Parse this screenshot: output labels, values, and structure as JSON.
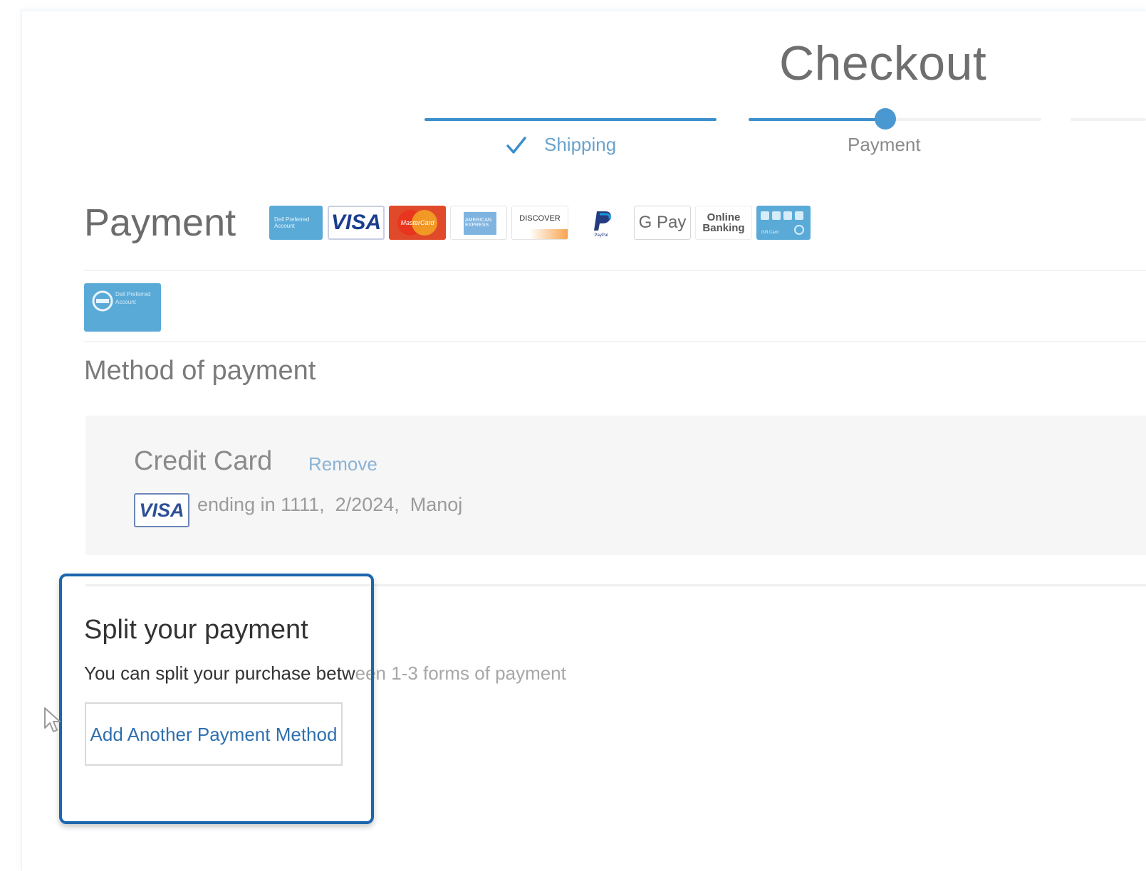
{
  "page": {
    "title": "Checkout"
  },
  "progress": {
    "steps": [
      {
        "label": "Shipping",
        "status": "completed"
      },
      {
        "label": "Payment",
        "status": "current"
      }
    ]
  },
  "payment": {
    "heading": "Payment",
    "accepted_methods": [
      {
        "name": "dell-preferred-account",
        "text": "Dell Preferred Account"
      },
      {
        "name": "visa",
        "text": "VISA"
      },
      {
        "name": "mastercard",
        "text": "MasterCard"
      },
      {
        "name": "american-express",
        "text": "AMERICAN EXPRESS"
      },
      {
        "name": "discover",
        "text": "DISCOVER"
      },
      {
        "name": "paypal",
        "text": "PayPal"
      },
      {
        "name": "google-pay",
        "text": "G Pay"
      },
      {
        "name": "online-banking",
        "text": "Online Banking"
      },
      {
        "name": "gift-card",
        "text": "Gift Card"
      }
    ],
    "selected_badge_text": "Dell Preferred Account"
  },
  "method": {
    "heading": "Method of payment",
    "card": {
      "title": "Credit Card",
      "remove_label": "Remove",
      "brand": "VISA",
      "details": "ending in 1111,  2/2024,  Manoj"
    }
  },
  "split": {
    "heading": "Split your payment",
    "description_dark": "You can split your purchase betw",
    "description_light": "een 1-3 forms of payment",
    "button_label": "Add Another Payment Method"
  },
  "colors": {
    "accent": "#3d8fcc",
    "highlight_border": "#1c66ad",
    "link": "#2e6fad"
  }
}
